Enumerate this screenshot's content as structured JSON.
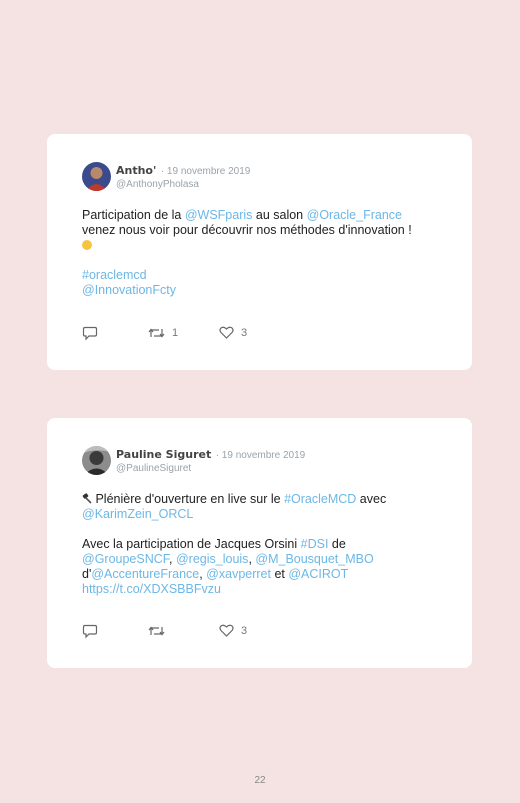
{
  "tweets": [
    {
      "author": "Antho'",
      "date": "· 19 novembre 2019",
      "handle": "@AnthonyPholasa",
      "line1": {
        "a": "Participation de la ",
        "b": "@WSFparis",
        "c": " au salon ",
        "d": "@Oracle_France"
      },
      "line2": "venez nous voir pour découvrir nos méthodes d'innovation !",
      "hashtag": "#oraclemcd",
      "mention": "@InnovationFcty",
      "retweets": "1",
      "likes": "3"
    },
    {
      "author": "Pauline Siguret",
      "date": "· 19 novembre 2019",
      "handle": "@PaulineSiguret",
      "line1": {
        "a": " Plénière d'ouverture en live sur le ",
        "b": "#OracleMCD",
        "c": " avec"
      },
      "line2": "@KarimZein_ORCL",
      "line3": {
        "a": "Avec la participation de Jacques Orsini ",
        "b": "#DSI",
        "c": " de"
      },
      "line4": {
        "a": "@GroupeSNCF",
        "b": ", ",
        "c": "@regis_louis",
        "d": ", ",
        "e": "@M_Bousquet_MBO"
      },
      "line5": {
        "a": "d'",
        "b": "@AccentureFrance",
        "c": ", ",
        "d": "@xavperret",
        "e": " et ",
        "f": "@ACIROT"
      },
      "line6": "https://t.co/XDXSBBFvzu",
      "retweets": "",
      "likes": "3"
    }
  ],
  "page_number": "22"
}
